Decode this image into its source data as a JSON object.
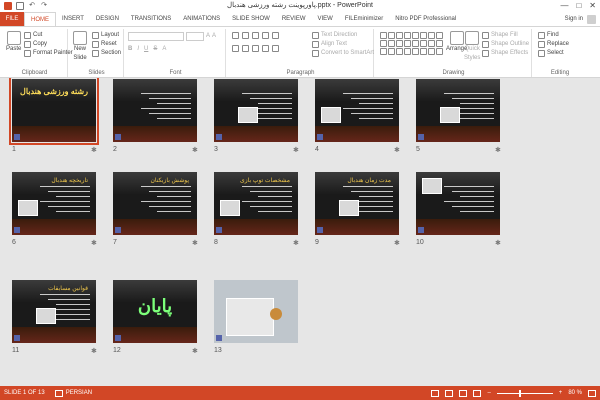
{
  "window": {
    "title": "پاورپوینت رشته ورزشی هندبال.pptx - PowerPoint",
    "min_glyph": "—",
    "max_glyph": "□",
    "close_glyph": "✕"
  },
  "qat": {
    "save_icon": "save-icon",
    "undo_glyph": "↶",
    "redo_glyph": "↷"
  },
  "tabs": {
    "file": "FILE",
    "items": [
      "HOME",
      "INSERT",
      "DESIGN",
      "TRANSITIONS",
      "ANIMATIONS",
      "SLIDE SHOW",
      "REVIEW",
      "VIEW",
      "FILEminimizer",
      "Nitro PDF Professional"
    ],
    "active": "HOME"
  },
  "account": {
    "signin": "Sign in"
  },
  "ribbon": {
    "clipboard": {
      "label": "Clipboard",
      "paste": "Paste",
      "cut": "Cut",
      "copy": "Copy",
      "format_painter": "Format Painter"
    },
    "slides": {
      "label": "Slides",
      "new_slide": "New",
      "new_slide2": "Slide",
      "layout": "Layout",
      "reset": "Reset",
      "section": "Section"
    },
    "font": {
      "label": "Font",
      "bold": "B",
      "italic": "I",
      "underline": "U",
      "strike": "S",
      "grow": "A",
      "shrink": "A",
      "color": "A"
    },
    "paragraph": {
      "label": "Paragraph",
      "text_direction": "Text Direction",
      "align_text": "Align Text",
      "convert_smartart": "Convert to SmartArt"
    },
    "drawing": {
      "label": "Drawing",
      "arrange": "Arrange",
      "quick_styles": "Quick",
      "quick_styles2": "Styles",
      "shape_fill": "Shape Fill",
      "shape_outline": "Shape Outline",
      "shape_effects": "Shape Effects"
    },
    "editing": {
      "label": "Editing",
      "find": "Find",
      "replace": "Replace",
      "select": "Select"
    }
  },
  "slides": [
    {
      "num": "1",
      "title": "رشته ورزشی هندبال"
    },
    {
      "num": "2",
      "title": ""
    },
    {
      "num": "3",
      "title": ""
    },
    {
      "num": "4",
      "title": ""
    },
    {
      "num": "5",
      "title": ""
    },
    {
      "num": "6",
      "title": "تاریخچه هندبال"
    },
    {
      "num": "7",
      "title": "پوشش بازیکنان"
    },
    {
      "num": "8",
      "title": "مشخصات توپ بازی"
    },
    {
      "num": "9",
      "title": "مدت زمان هندبال"
    },
    {
      "num": "10",
      "title": ""
    },
    {
      "num": "11",
      "title": "قوانین مسابقات"
    },
    {
      "num": "12",
      "title": "پایان"
    },
    {
      "num": "13",
      "title": ""
    }
  ],
  "slide_star": "✱",
  "selected_slide": 1,
  "status": {
    "slide": "SLIDE 1 OF 13",
    "language": "PERSIAN",
    "zoom": "80 %",
    "zoom_minus": "–",
    "zoom_plus": "+"
  }
}
